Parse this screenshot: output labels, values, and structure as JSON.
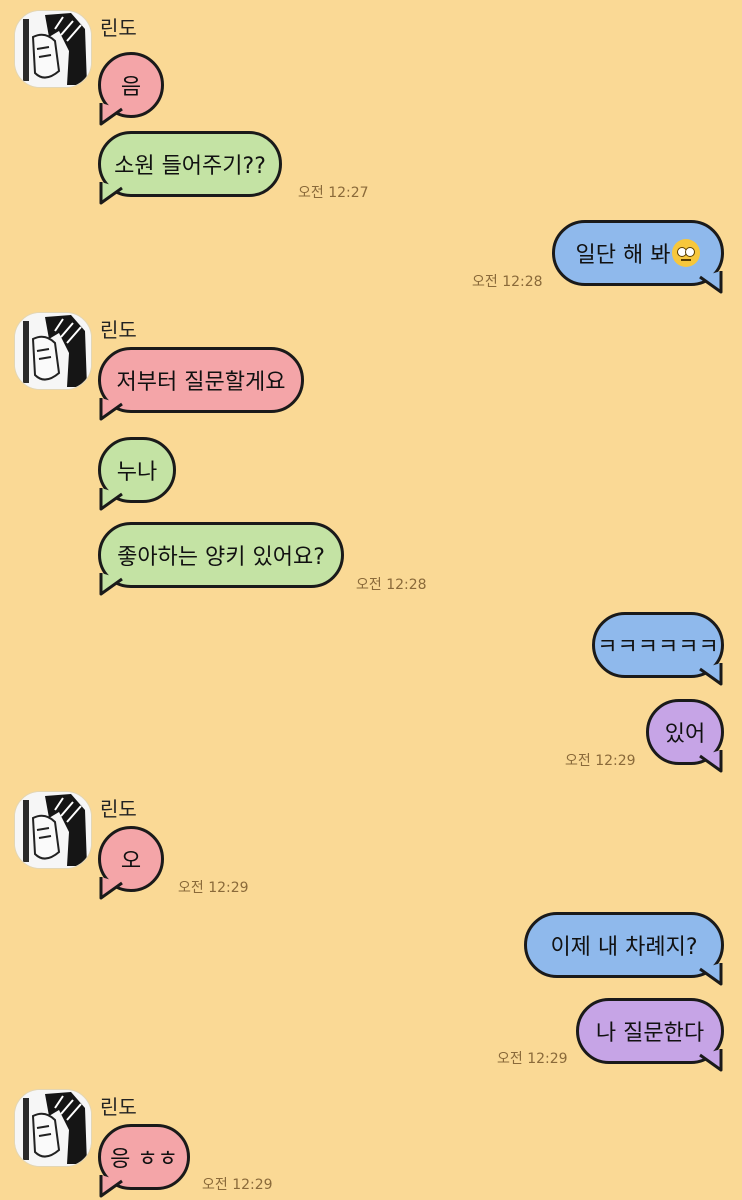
{
  "contact": {
    "name": "린도",
    "avatar_icon": "manga-avatar-icon"
  },
  "colors": {
    "background": "#fad995",
    "pink_bubble": "#f4a5a8",
    "green_bubble": "#c4e3a4",
    "blue_bubble": "#8fb9ec",
    "purple_bubble": "#c6a4e6"
  },
  "messages": [
    {
      "sender": "린도",
      "text": "음",
      "time": ""
    },
    {
      "sender": "린도",
      "text": "소원 들어주기??",
      "time": "오전 12:27"
    },
    {
      "sender": "me",
      "text": "일단 해 봐",
      "emoji": "eye-roll-emoji-icon",
      "time": "오전 12:28"
    },
    {
      "sender": "린도",
      "text": "저부터 질문할게요",
      "time": ""
    },
    {
      "sender": "린도",
      "text": "누나",
      "time": ""
    },
    {
      "sender": "린도",
      "text": "좋아하는 양키 있어요?",
      "time": "오전 12:28"
    },
    {
      "sender": "me",
      "text": "ㅋㅋㅋㅋㅋㅋ",
      "time": ""
    },
    {
      "sender": "me",
      "text": "있어",
      "time": "오전 12:29"
    },
    {
      "sender": "린도",
      "text": "오",
      "time": "오전 12:29"
    },
    {
      "sender": "me",
      "text": "이제 내 차례지?",
      "time": ""
    },
    {
      "sender": "me",
      "text": "나 질문한다",
      "time": "오전 12:29"
    },
    {
      "sender": "린도",
      "text": "응 ㅎㅎ",
      "time": "오전 12:29"
    }
  ]
}
